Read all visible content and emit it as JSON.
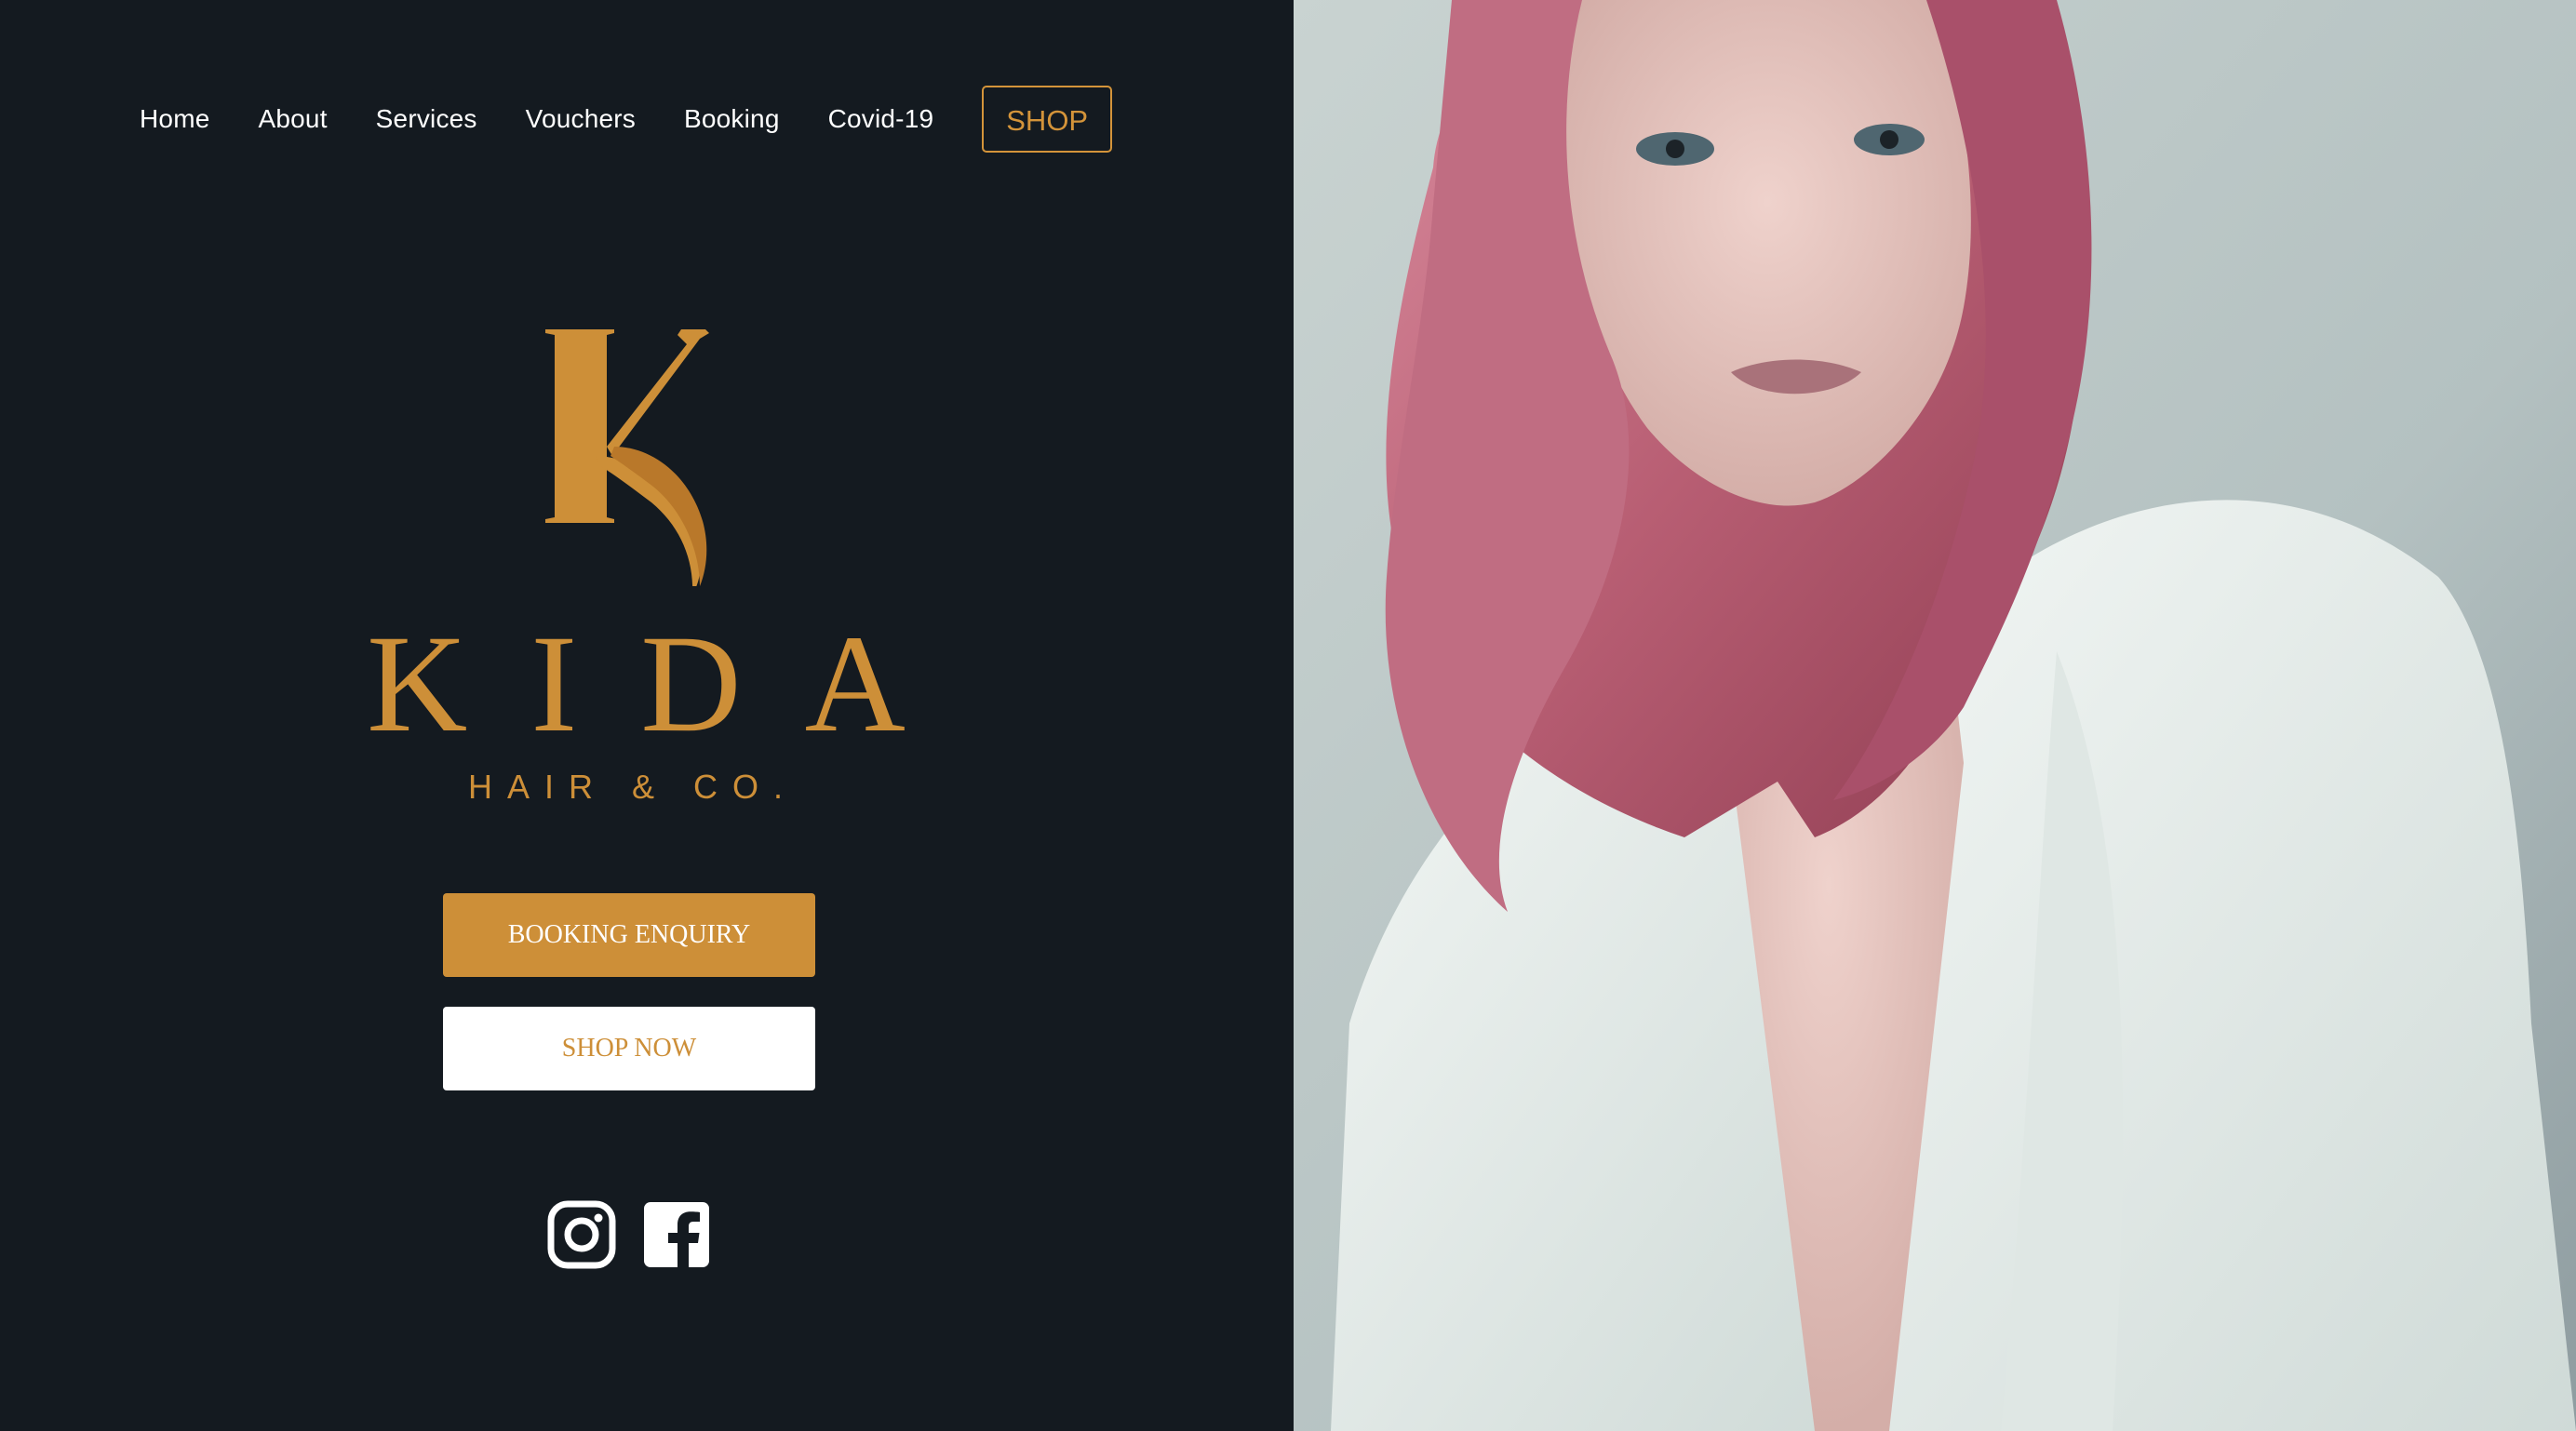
{
  "nav": {
    "items": [
      {
        "label": "Home"
      },
      {
        "label": "About"
      },
      {
        "label": "Services"
      },
      {
        "label": "Vouchers"
      },
      {
        "label": "Booking"
      },
      {
        "label": "Covid-19"
      }
    ],
    "shop_label": "SHOP"
  },
  "brand": {
    "monogram": "K",
    "name": "KIDA",
    "tagline": "HAIR & CO."
  },
  "actions": {
    "booking_label": "BOOKING ENQUIRY",
    "shop_label": "SHOP NOW"
  },
  "social": {
    "icons": [
      "instagram-icon",
      "facebook-icon"
    ]
  },
  "hero": {
    "icon": "portrait-photo"
  },
  "colors": {
    "background": "#141a20",
    "accent": "#cd8f38",
    "text": "#ffffff"
  }
}
